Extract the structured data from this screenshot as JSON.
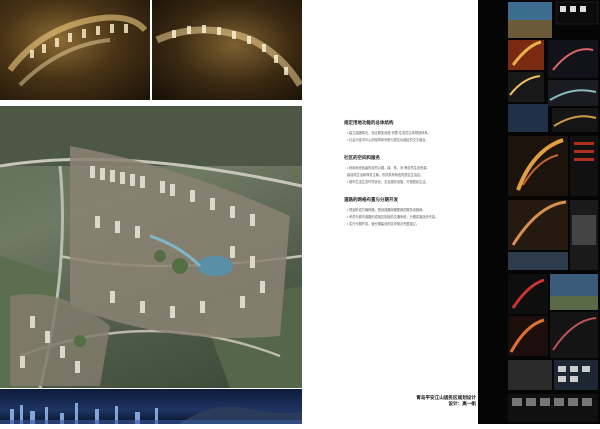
{
  "panel": {
    "sections": [
      {
        "heading": "规定用地功能的总体结构",
        "bullets": [
          "• 建立组团单元，社区服务设施-邻里-住宅的主体规划体系。",
          "• 社会与经济中心的结构体系是与居住功能区的交叉组合。"
        ]
      },
      {
        "heading": "社区的空间和服务",
        "bullets": [
          "• 利用地块各级的自然公园、绿、林、河 等自然生态资源，",
          "  建设成生活和商务主轴，形成具有特色的居住生活区。",
          "• 城市生活生态环境优化，交互服务设施，方便居民生活。"
        ]
      },
      {
        "heading": "道路的网格布置与分期开发",
        "bullets": [
          "• 规划形成方格网路，规划道路网格配置的服务设施网。",
          "• 考虑与城市道路形成相互衔接的交通系统，分期实施逐步完善。",
          "• 实行分期开发，使分期建设的区块相对完整独立。"
        ]
      }
    ]
  },
  "caption": {
    "title": "青岛平安江山居民区规划设计",
    "designer": "设计：高一帆"
  },
  "colors": {
    "right_bg": "#050505",
    "text_dark": "#222222"
  }
}
